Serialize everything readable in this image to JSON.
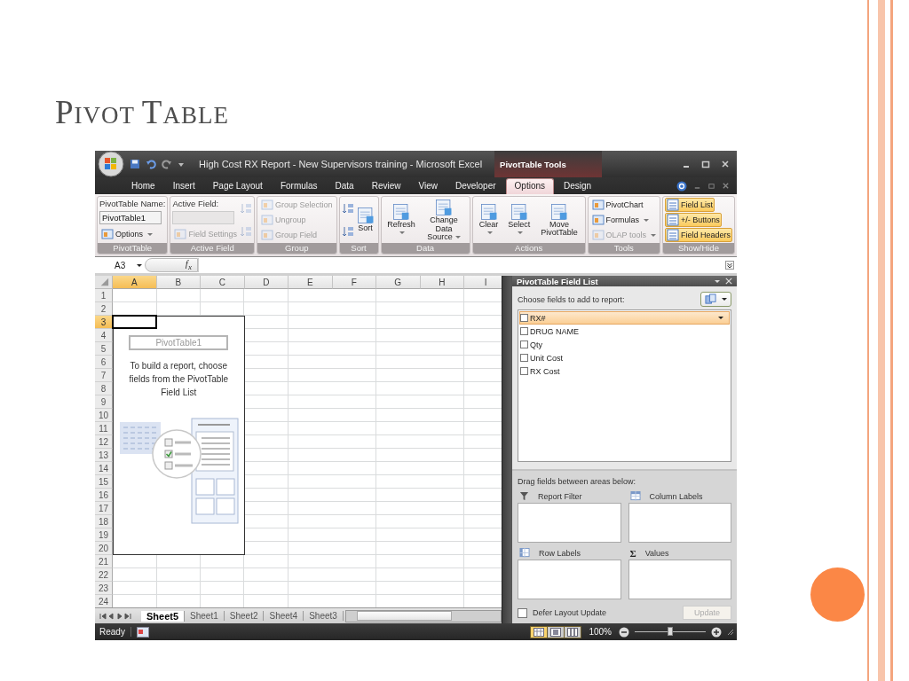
{
  "slide": {
    "title_words": [
      "PIVOT",
      "TABLE"
    ]
  },
  "window": {
    "title": "High Cost RX Report - New Supervisors training - Microsoft Excel",
    "contextual_label": "PivotTable Tools"
  },
  "tabs": [
    {
      "label": "Home",
      "selected": false
    },
    {
      "label": "Insert",
      "selected": false
    },
    {
      "label": "Page Layout",
      "selected": false
    },
    {
      "label": "Formulas",
      "selected": false
    },
    {
      "label": "Data",
      "selected": false
    },
    {
      "label": "Review",
      "selected": false
    },
    {
      "label": "View",
      "selected": false
    },
    {
      "label": "Developer",
      "selected": false
    },
    {
      "label": "Options",
      "selected": true
    },
    {
      "label": "Design",
      "selected": false
    }
  ],
  "ribbon_groups": [
    {
      "title": "PivotTable",
      "columns": [
        [
          {
            "kind": "label",
            "text": "PivotTable Name:"
          },
          {
            "kind": "field",
            "value": "PivotTable1",
            "disabled": false
          },
          {
            "kind": "small",
            "label": "Options",
            "dropdown": true,
            "disabled": false
          }
        ]
      ]
    },
    {
      "title": "Active Field",
      "columns": [
        [
          {
            "kind": "label",
            "text": "Active Field:"
          },
          {
            "kind": "field",
            "disabled": true
          },
          {
            "kind": "small",
            "label": "Field Settings",
            "dropdown": false,
            "disabled": true
          }
        ],
        [
          {
            "kind": "icon",
            "disabled": true
          },
          {
            "kind": "icon",
            "disabled": true
          }
        ]
      ]
    },
    {
      "title": "Group",
      "columns": [
        [
          {
            "kind": "small",
            "label": "Group Selection",
            "dropdown": false,
            "disabled": true
          },
          {
            "kind": "small",
            "label": "Ungroup",
            "dropdown": false,
            "disabled": true
          },
          {
            "kind": "small",
            "label": "Group Field",
            "dropdown": false,
            "disabled": true
          }
        ]
      ]
    },
    {
      "title": "Sort",
      "columns": [
        [
          {
            "kind": "icon",
            "disabled": false
          },
          {
            "kind": "icon",
            "disabled": false
          }
        ],
        [
          {
            "kind": "large",
            "label": "Sort",
            "dropdown": false,
            "disabled": false
          }
        ]
      ]
    },
    {
      "title": "Data",
      "columns": [
        [
          {
            "kind": "large",
            "label": "Refresh",
            "dropdown": true,
            "disabled": false
          }
        ],
        [
          {
            "kind": "large",
            "label": "Change Data Source",
            "dropdown": true,
            "disabled": false
          }
        ]
      ]
    },
    {
      "title": "Actions",
      "columns": [
        [
          {
            "kind": "large",
            "label": "Clear",
            "dropdown": true,
            "disabled": false
          }
        ],
        [
          {
            "kind": "large",
            "label": "Select",
            "dropdown": true,
            "disabled": false
          }
        ],
        [
          {
            "kind": "large",
            "label": "Move PivotTable",
            "dropdown": false,
            "disabled": false
          }
        ]
      ]
    },
    {
      "title": "Tools",
      "columns": [
        [
          {
            "kind": "small",
            "label": "PivotChart",
            "dropdown": false,
            "disabled": false
          },
          {
            "kind": "small",
            "label": "Formulas",
            "dropdown": true,
            "disabled": false
          },
          {
            "kind": "small",
            "label": "OLAP tools",
            "dropdown": true,
            "disabled": true
          }
        ]
      ]
    },
    {
      "title": "Show/Hide",
      "columns": [
        [
          {
            "kind": "toggle",
            "label": "Field List",
            "on": true
          },
          {
            "kind": "toggle",
            "label": "+/- Buttons",
            "on": true
          },
          {
            "kind": "toggle",
            "label": "Field Headers",
            "on": true
          }
        ]
      ]
    }
  ],
  "formula_bar": {
    "name_box": "A3",
    "function_label": "f$_{x}$"
  },
  "grid": {
    "columns": [
      {
        "label": "A",
        "selected": true
      },
      {
        "label": "B",
        "selected": false
      },
      {
        "label": "C",
        "selected": false
      },
      {
        "label": "D",
        "selected": false
      },
      {
        "label": "E",
        "selected": false
      },
      {
        "label": "F",
        "selected": false
      },
      {
        "label": "G",
        "selected": false
      },
      {
        "label": "H",
        "selected": false
      },
      {
        "label": "I",
        "selected": false
      }
    ],
    "rows": [
      {
        "label": "1",
        "selected": false
      },
      {
        "label": "2",
        "selected": false
      },
      {
        "label": "3",
        "selected": true
      },
      {
        "label": "4",
        "selected": false
      },
      {
        "label": "5",
        "selected": false
      },
      {
        "label": "6",
        "selected": false
      },
      {
        "label": "7",
        "selected": false
      },
      {
        "label": "8",
        "selected": false
      },
      {
        "label": "9",
        "selected": false
      },
      {
        "label": "10",
        "selected": false
      },
      {
        "label": "11",
        "selected": false
      },
      {
        "label": "12",
        "selected": false
      },
      {
        "label": "13",
        "selected": false
      },
      {
        "label": "14",
        "selected": false
      },
      {
        "label": "15",
        "selected": false
      },
      {
        "label": "16",
        "selected": false
      },
      {
        "label": "17",
        "selected": false
      },
      {
        "label": "18",
        "selected": false
      },
      {
        "label": "19",
        "selected": false
      },
      {
        "label": "20",
        "selected": false
      },
      {
        "label": "21",
        "selected": false
      },
      {
        "label": "22",
        "selected": false
      },
      {
        "label": "23",
        "selected": false
      },
      {
        "label": "24",
        "selected": false
      }
    ]
  },
  "pivot_placeholder": {
    "name": "PivotTable1",
    "message": "To build a report, choose fields from the PivotTable Field List"
  },
  "sheet_tabs": [
    {
      "label": "Sheet5",
      "selected": true
    },
    {
      "label": "Sheet1",
      "selected": false
    },
    {
      "label": "Sheet2",
      "selected": false
    },
    {
      "label": "Sheet4",
      "selected": false
    },
    {
      "label": "Sheet3",
      "selected": false
    }
  ],
  "field_list": {
    "title": "PivotTable Field List",
    "prompt": "Choose fields to add to report:",
    "fields": [
      {
        "name": "RX#",
        "checked": false,
        "selected": true
      },
      {
        "name": "DRUG NAME",
        "checked": false,
        "selected": false
      },
      {
        "name": "Qty",
        "checked": false,
        "selected": false
      },
      {
        "name": "Unit Cost",
        "checked": false,
        "selected": false
      },
      {
        "name": "RX Cost",
        "checked": false,
        "selected": false
      }
    ],
    "areas_prompt": "Drag fields between areas below:",
    "areas": [
      {
        "kind": "filter",
        "label": "Report Filter"
      },
      {
        "kind": "columns",
        "label": "Column Labels"
      },
      {
        "kind": "rows",
        "label": "Row Labels"
      },
      {
        "kind": "values",
        "label": "Values",
        "symbol": "Σ"
      }
    ],
    "defer": {
      "label": "Defer Layout Update",
      "checked": false
    },
    "update_button": {
      "label": "Update",
      "disabled": true
    }
  },
  "status_bar": {
    "text": "Ready",
    "view_buttons": [
      {
        "kind": "normal",
        "selected": true
      },
      {
        "kind": "layout",
        "selected": false
      },
      {
        "kind": "pagebreak",
        "selected": false
      }
    ],
    "zoom": "100%",
    "zoom_slider": {
      "level": 0.5
    }
  }
}
